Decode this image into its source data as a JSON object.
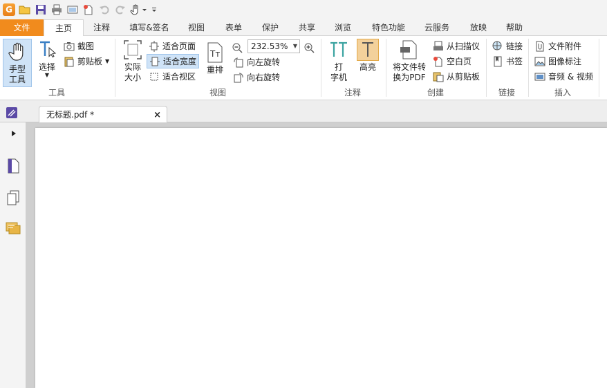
{
  "quick_access": {
    "app_logo_letter": "G",
    "icons": [
      "open-icon",
      "save-icon",
      "print-icon",
      "scan-icon",
      "new-icon",
      "undo-icon",
      "redo-icon",
      "hand-dropdown-icon",
      "customize-icon"
    ]
  },
  "tabs": [
    "文件",
    "主页",
    "注释",
    "填写&签名",
    "视图",
    "表单",
    "保护",
    "共享",
    "浏览",
    "特色功能",
    "云服务",
    "放映",
    "帮助"
  ],
  "ribbon": {
    "tools": {
      "label": "工具",
      "hand_line1": "手型",
      "hand_line2": "工具",
      "select": "选择",
      "screenshot": "截图",
      "clipboard": "剪贴板"
    },
    "view": {
      "label": "视图",
      "actual_line1": "实际",
      "actual_line2": "大小",
      "fit_page": "适合页面",
      "fit_width": "适合宽度",
      "fit_visible": "适合视区",
      "reflow": "重排",
      "zoom_value": "232.53%",
      "rotate_left": "向左旋转",
      "rotate_right": "向右旋转"
    },
    "annotate": {
      "label": "注释",
      "typewriter_line1": "打",
      "typewriter_line2": "字机",
      "highlight": "高亮"
    },
    "create": {
      "label": "创建",
      "convert_line1": "将文件转",
      "convert_line2": "换为PDF",
      "from_scanner": "从扫描仪",
      "blank_page": "空白页",
      "from_clipboard": "从剪贴板"
    },
    "links": {
      "label": "链接",
      "link": "链接",
      "bookmark": "书签"
    },
    "insert": {
      "label": "插入",
      "file_attachment": "文件附件",
      "image_annotation": "图像标注",
      "audio_video": "音频 & 视频"
    }
  },
  "document_tab": {
    "title": "无标题.pdf *",
    "close": "×"
  },
  "colors": {
    "file_tab": "#f18b1d",
    "selected": "#cfe3f7",
    "highlight": "#f3d19b"
  }
}
